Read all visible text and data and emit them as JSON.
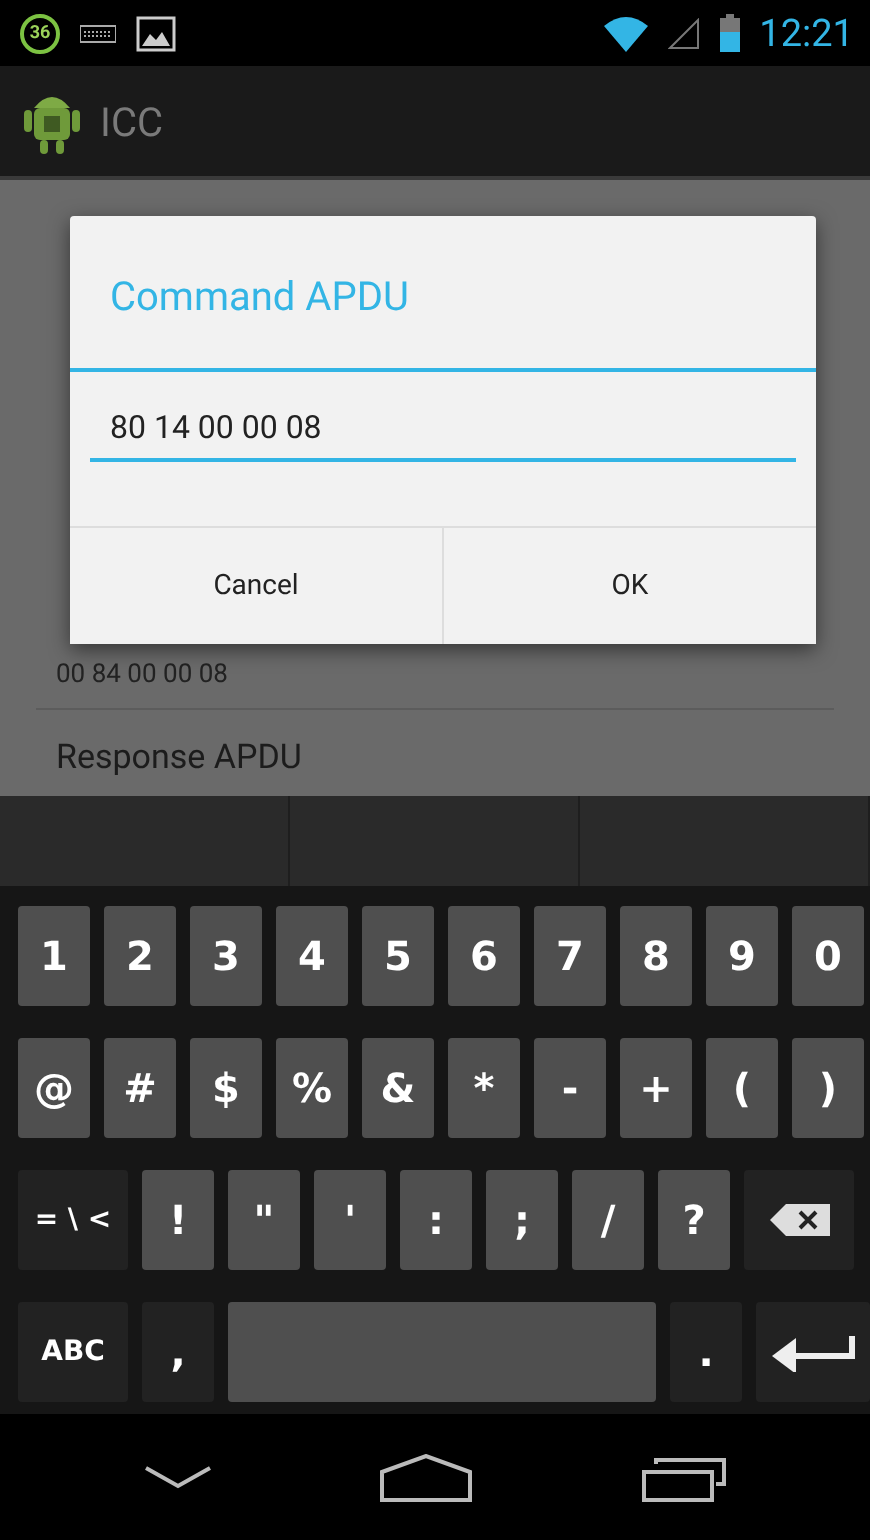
{
  "status_bar": {
    "notification_count": "36",
    "time": "12:21"
  },
  "action_bar": {
    "title": "ICC"
  },
  "background_list": {
    "command_value": "00 84 00 00 08",
    "response_header": "Response APDU"
  },
  "dialog": {
    "title": "Command APDU",
    "input_value": "80 14 00 00 08",
    "buttons": [
      {
        "label": "Cancel"
      },
      {
        "label": "OK"
      }
    ]
  },
  "keyboard": {
    "rows": [
      [
        {
          "label": "1",
          "kind": "char"
        },
        {
          "label": "2",
          "kind": "char"
        },
        {
          "label": "3",
          "kind": "char"
        },
        {
          "label": "4",
          "kind": "char"
        },
        {
          "label": "5",
          "kind": "char"
        },
        {
          "label": "6",
          "kind": "char"
        },
        {
          "label": "7",
          "kind": "char"
        },
        {
          "label": "8",
          "kind": "char"
        },
        {
          "label": "9",
          "kind": "char"
        },
        {
          "label": "0",
          "kind": "char"
        }
      ],
      [
        {
          "label": "@",
          "kind": "char"
        },
        {
          "label": "#",
          "kind": "char"
        },
        {
          "label": "$",
          "kind": "char"
        },
        {
          "label": "%",
          "kind": "char"
        },
        {
          "label": "&",
          "kind": "char"
        },
        {
          "label": "*",
          "kind": "char"
        },
        {
          "label": "-",
          "kind": "char"
        },
        {
          "label": "+",
          "kind": "char"
        },
        {
          "label": "(",
          "kind": "char"
        },
        {
          "label": ")",
          "kind": "char"
        }
      ],
      [
        {
          "label": "= \\ <",
          "kind": "toggle"
        },
        {
          "label": "!",
          "kind": "char"
        },
        {
          "label": "\"",
          "kind": "char"
        },
        {
          "label": "'",
          "kind": "char"
        },
        {
          "label": ":",
          "kind": "char"
        },
        {
          "label": ";",
          "kind": "char"
        },
        {
          "label": "/",
          "kind": "char"
        },
        {
          "label": "?",
          "kind": "char"
        },
        {
          "kind": "backspace"
        }
      ],
      [
        {
          "label": "ABC",
          "kind": "toggle"
        },
        {
          "label": ",",
          "kind": "mod"
        },
        {
          "kind": "space"
        },
        {
          "label": ".",
          "kind": "mod"
        },
        {
          "kind": "enter"
        }
      ]
    ]
  }
}
